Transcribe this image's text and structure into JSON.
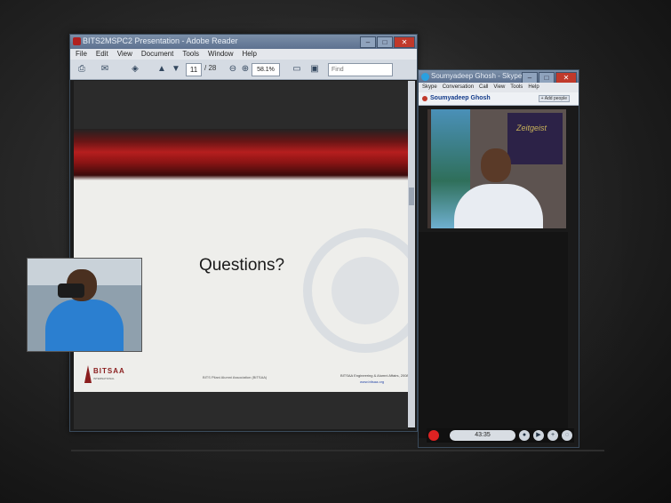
{
  "pdf_reader": {
    "title": "BITS2MSPC2 Presentation - Adobe Reader",
    "menu": [
      "File",
      "Edit",
      "View",
      "Document",
      "Tools",
      "Window",
      "Help"
    ],
    "toolbar": {
      "page_current": "11",
      "page_total": "/ 28",
      "zoom": "58.1%",
      "find_placeholder": "Find"
    },
    "slide": {
      "heading": "Questions?",
      "logo_text": "BITSAA",
      "logo_sub": "INTERNATIONAL",
      "footer_center": "BITS Pilani Alumni Association (BITSAA)",
      "footer_right": "BITSAA Engineering & Alumni Affairs, 2008",
      "footer_link": "www.bitsaa.org"
    }
  },
  "skype": {
    "title": "Soumyadeep Ghosh - Skype",
    "menu": [
      "Skype",
      "Conversation",
      "Call",
      "View",
      "Tools",
      "Help"
    ],
    "contact_name": "Soumyadeep Ghosh",
    "add_people_label": "+ Add people",
    "call_timer": "43:35",
    "colors": {
      "end_call": "#dd2222",
      "status": "#c0392b"
    }
  },
  "remote_poster_text": "Zeitgeist"
}
